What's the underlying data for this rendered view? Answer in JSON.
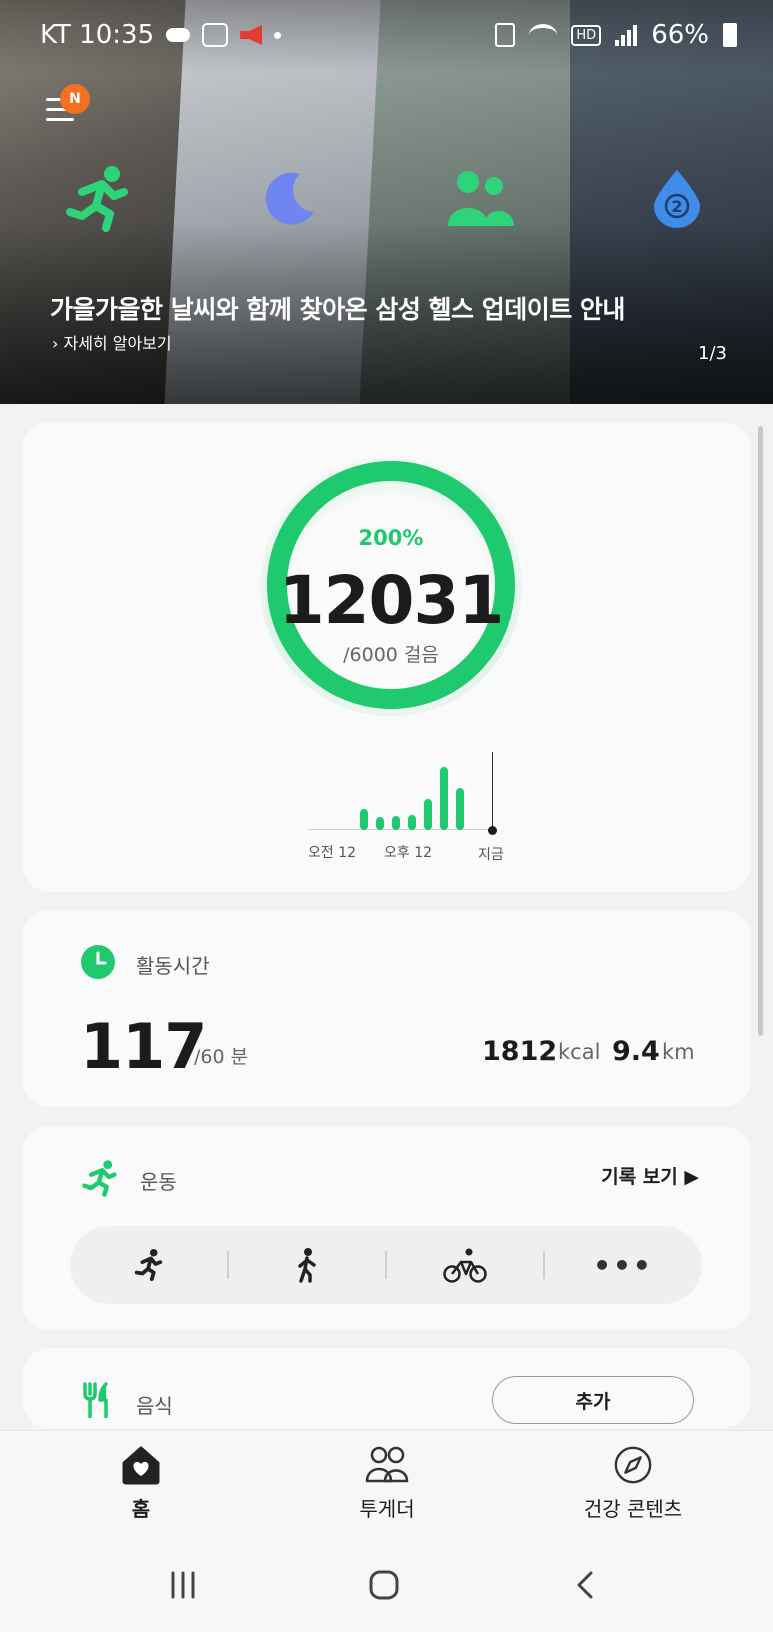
{
  "status_bar": {
    "carrier_time": "KT 10:35",
    "battery": "66%"
  },
  "hero": {
    "badge": "N",
    "title": "가을가을한 날씨와 함께 찾아온 삼성 헬스 업데이트 안내",
    "link": "› 자세히 알아보기",
    "page_indicator": "1/3",
    "water_count": "2"
  },
  "steps": {
    "percent": "200%",
    "count": "12031",
    "goal": "/6000 걸음",
    "progress_fraction": 2.0,
    "hourly_bars": [
      0.3,
      0.18,
      0.2,
      0.22,
      0.45,
      0.9,
      0.6
    ],
    "tick_am": "오전 12",
    "tick_pm": "오후 12",
    "tick_now": "지금",
    "accent_color": "#1fc96e"
  },
  "active_time": {
    "label": "활동시간",
    "value": "117",
    "unit": "/60 분",
    "kcal_value": "1812",
    "kcal_unit": "kcal",
    "km_value": "9.4",
    "km_unit": "km"
  },
  "exercise": {
    "label": "운동",
    "history_link": "기록 보기 ▶",
    "types": [
      "running-icon",
      "walking-icon",
      "cycling-icon",
      "more-icon"
    ],
    "more_label": "•••"
  },
  "food": {
    "label": "음식",
    "add_button": "추가"
  },
  "bottom_nav": {
    "home": "홈",
    "together": "투게더",
    "discover": "건강 콘텐츠"
  }
}
